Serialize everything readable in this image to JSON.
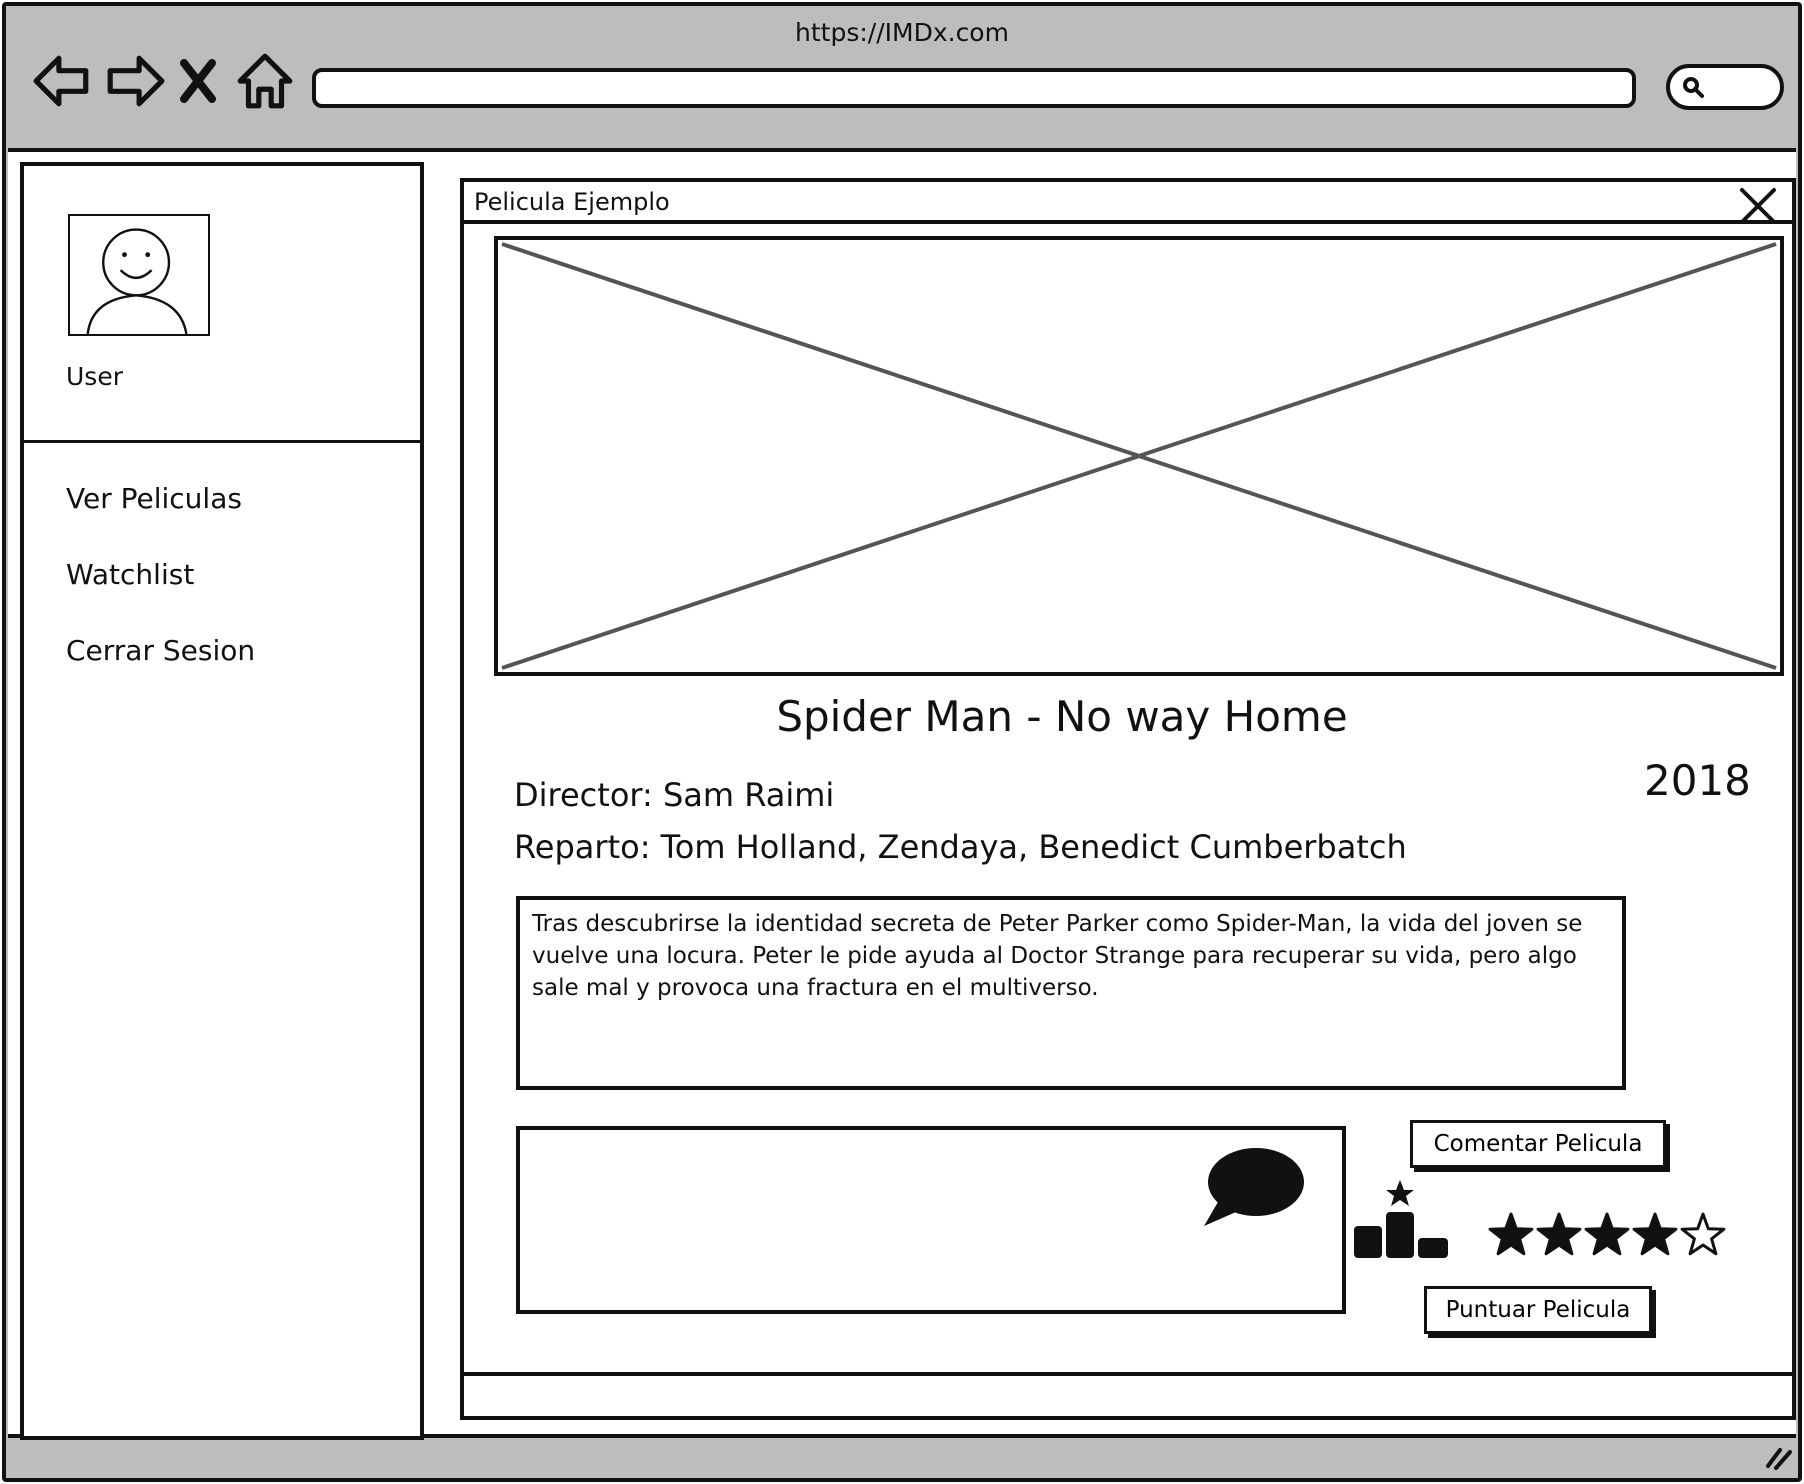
{
  "browser": {
    "url": "https://IMDx.com",
    "search_placeholder": ""
  },
  "sidebar": {
    "user_label": "User",
    "items": [
      {
        "label": "Ver Peliculas"
      },
      {
        "label": "Watchlist"
      },
      {
        "label": "Cerrar Sesion"
      }
    ]
  },
  "movie_window": {
    "title": "Pelicula Ejemplo",
    "movie_title": "Spider Man - No way Home",
    "year": "2018",
    "director": "Director: Sam Raimi",
    "cast": "Reparto:  Tom Holland, Zendaya, Benedict Cumberbatch",
    "synopsis": "Tras descubrirse la identidad secreta de Peter Parker como Spider-Man, la vida del joven se vuelve una locura. Peter le pide ayuda al Doctor Strange para recuperar su vida, pero algo sale mal y provoca una fractura en el multiverso.",
    "comment_button": "Comentar Pelicula",
    "rate_button": "Puntuar Pelicula",
    "rating": {
      "value": 4,
      "max": 5
    }
  },
  "icons": {
    "back": "arrow-left-icon",
    "forward": "arrow-right-icon",
    "stop": "close-icon",
    "home": "home-icon",
    "search": "search-icon",
    "close_window": "close-icon",
    "comment": "speech-bubble-icon",
    "ranking": "ranking-icon",
    "star": "star-icon"
  }
}
